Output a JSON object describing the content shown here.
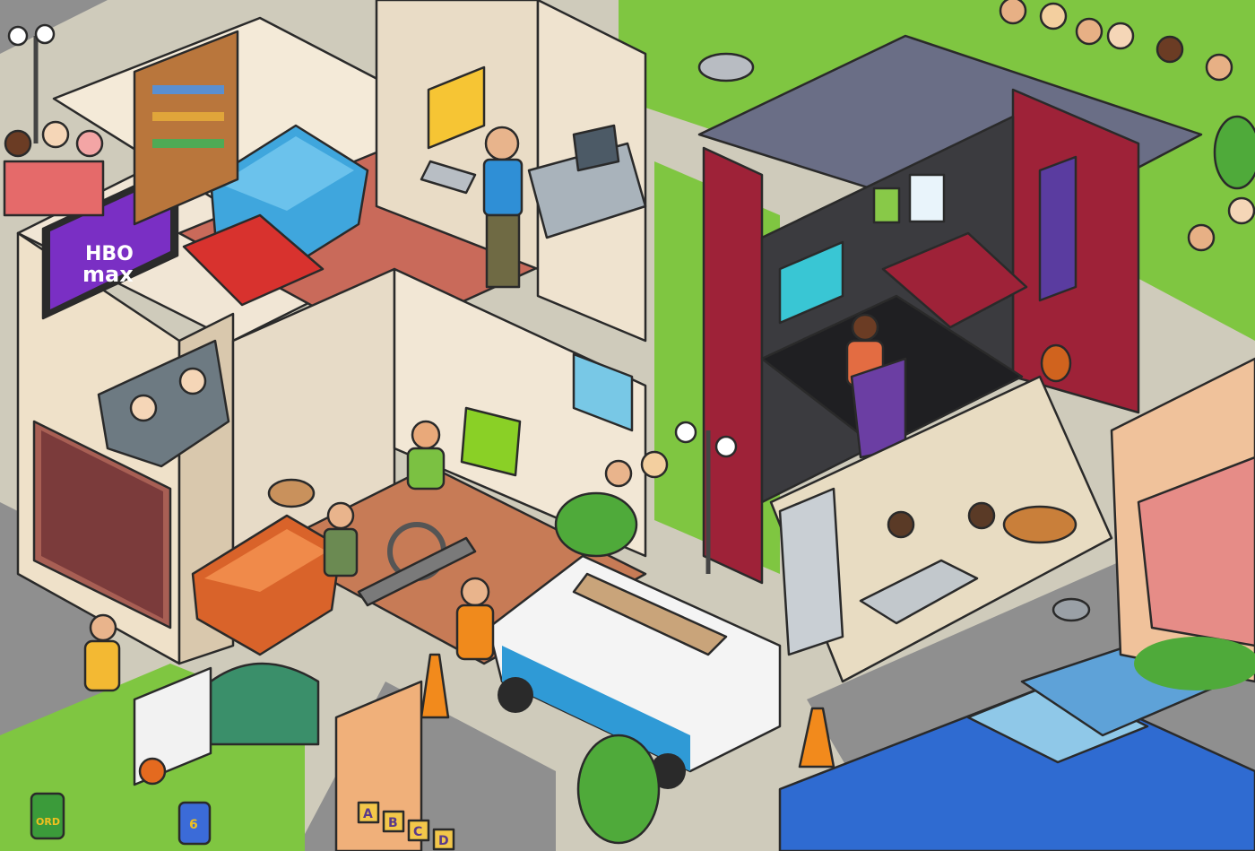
{
  "illustration": {
    "tv_brand_line1": "HBO",
    "tv_brand_line2": "max",
    "block_letters": [
      "A",
      "B",
      "C",
      "D"
    ],
    "jersey_number": "6",
    "jersey_text": "ORD",
    "colors": {
      "street": "#8f8f8f",
      "sidewalk": "#e4e1d3",
      "grass": "#7fc641",
      "house_red": "#9e2238",
      "roof": "#6a6e86",
      "tv_screen": "#7a2fc4",
      "outline": "#2a2a2a"
    }
  }
}
